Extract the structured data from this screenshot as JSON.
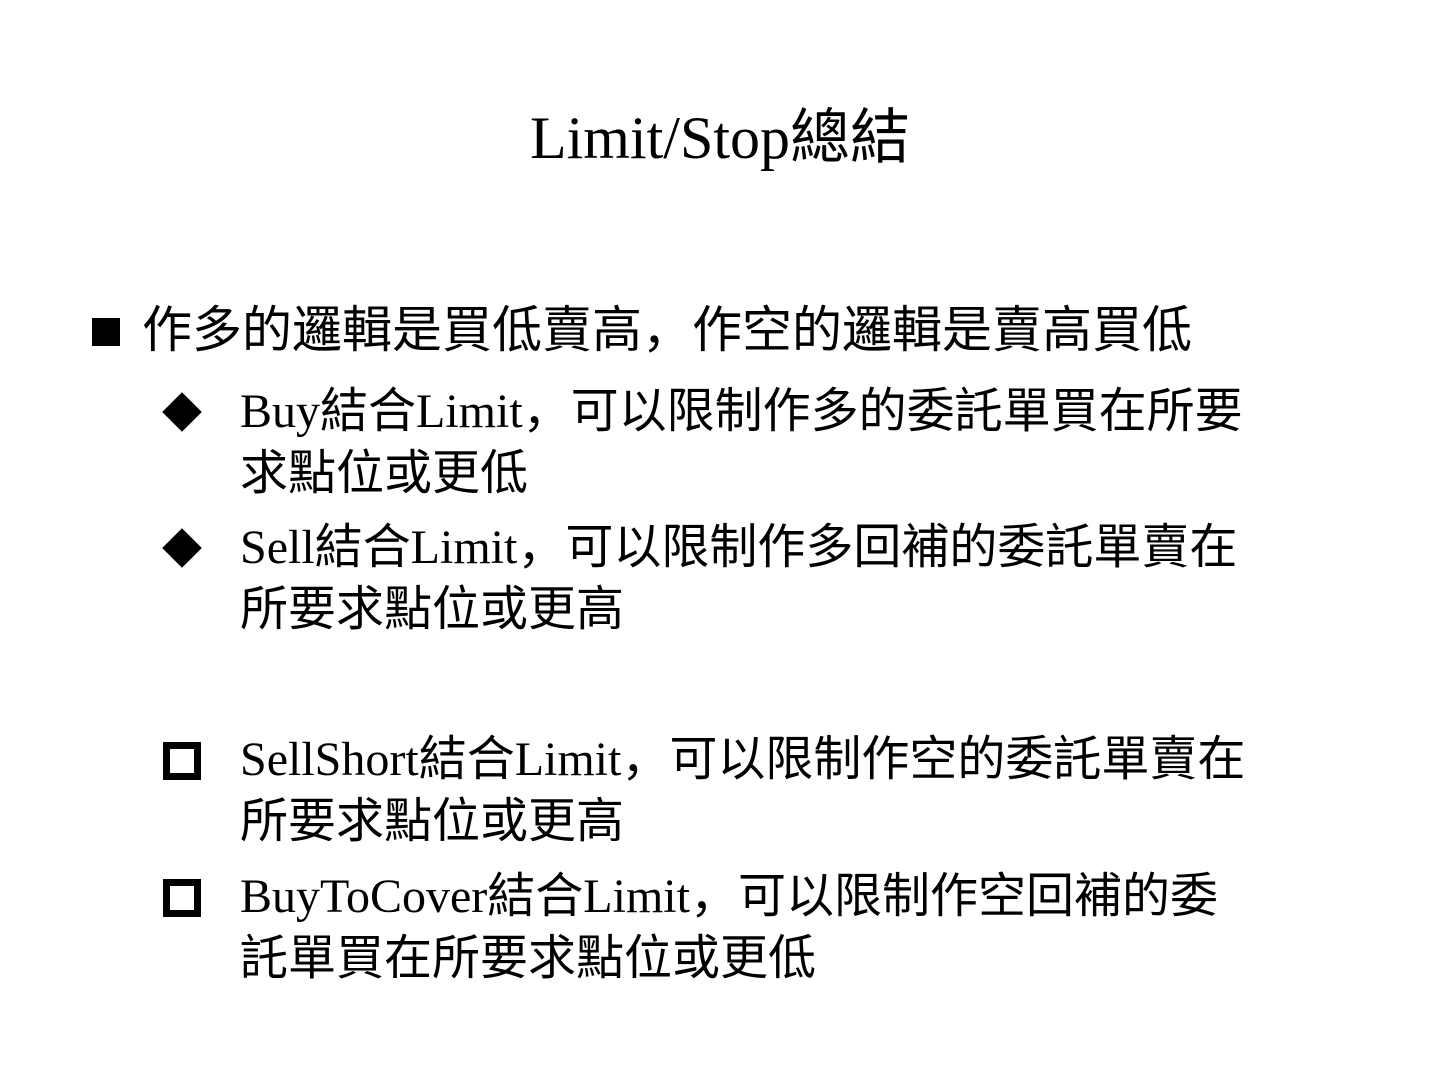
{
  "slide": {
    "title": "Limit/Stop總結",
    "level1": {
      "bullet_icon": "filled-square-bullet",
      "text": "作多的邏輯是買低賣高，作空的邏輯是賣高買低"
    },
    "items": [
      {
        "bullet_icon": "diamond-bullet",
        "text": "Buy結合Limit，可以限制作多的委託單買在所要\n求點位或更低"
      },
      {
        "bullet_icon": "diamond-bullet",
        "text": "Sell結合Limit，可以限制作多回補的委託單賣在\n所要求點位或更高"
      },
      {
        "bullet_icon": "hollow-square-bullet",
        "text": "SellShort結合Limit，可以限制作空的委託單賣在\n所要求點位或更高"
      },
      {
        "bullet_icon": "hollow-square-bullet",
        "text": "BuyToCover結合Limit，可以限制作空回補的委\n託單買在所要求點位或更低"
      }
    ]
  }
}
